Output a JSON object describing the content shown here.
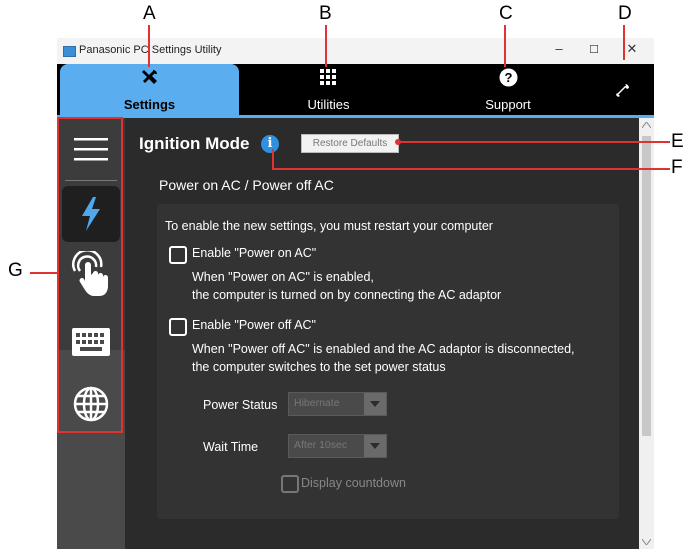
{
  "callouts": {
    "a": "A",
    "b": "B",
    "c": "C",
    "d": "D",
    "e": "E",
    "f": "F",
    "g": "G"
  },
  "window": {
    "title": "Panasonic PC Settings Utility",
    "minimize": "–",
    "maximize": "☐",
    "close": "✕"
  },
  "tabs": [
    {
      "label": "Settings",
      "icon": "tools-icon"
    },
    {
      "label": "Utilities",
      "icon": "grid-icon"
    },
    {
      "label": "Support",
      "icon": "question-icon"
    },
    {
      "label": "",
      "icon": "wrench-icon"
    }
  ],
  "sidebar": [
    {
      "icon": "menu-icon"
    },
    {
      "icon": "lightning-icon"
    },
    {
      "icon": "touch-icon"
    },
    {
      "icon": "keyboard-icon"
    },
    {
      "icon": "globe-icon"
    }
  ],
  "main": {
    "title": "Ignition Mode",
    "info": "i",
    "restore_label": "Restore Defaults",
    "section_title": "Power on AC / Power off AC",
    "restart_note": "To enable the new settings, you must restart your computer",
    "power_on": {
      "label": "Enable \"Power on AC\"",
      "desc1": "When \"Power on AC\" is enabled,",
      "desc2": "the computer is turned on by connecting the AC adaptor"
    },
    "power_off": {
      "label": "Enable \"Power off AC\"",
      "desc1": "When \"Power off AC\" is enabled and the AC adaptor is disconnected,",
      "desc2": "the computer switches to the set power status"
    },
    "power_status": {
      "label": "Power Status",
      "value": "Hibernate"
    },
    "wait_time": {
      "label": "Wait Time",
      "value": "After 10sec"
    },
    "countdown_label": "Display countdown"
  },
  "colors": {
    "accent": "#5aaef0",
    "callout": "#e0332f",
    "info": "#2f8fe0"
  }
}
